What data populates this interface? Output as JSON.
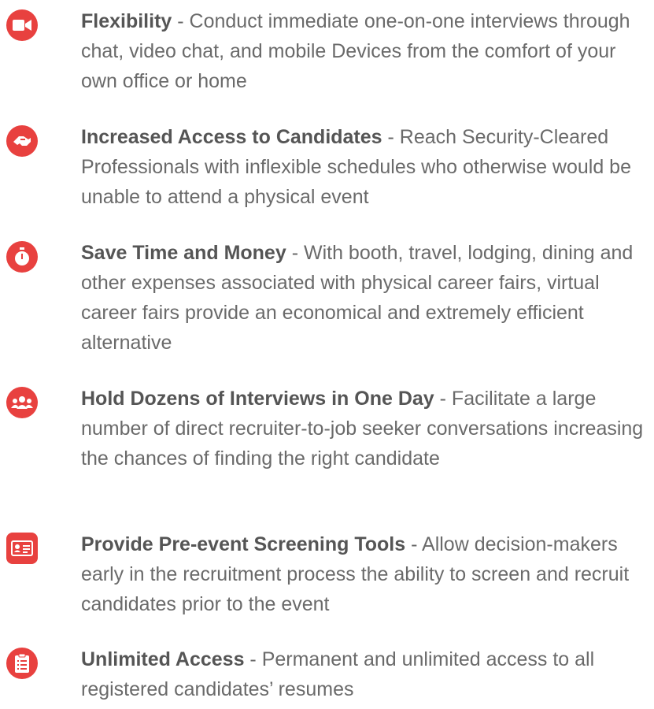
{
  "features": [
    {
      "icon": "video-camera-icon",
      "title": "Flexibility",
      "separator": " - ",
      "desc": "Conduct immediate one-on-one interviews through chat, video chat, and mobile Devices from the comfort of your own office or home"
    },
    {
      "icon": "handshake-icon",
      "title": "Increased Access to Candidates",
      "separator": " - ",
      "desc": "Reach Security-Cleared Professionals with inflexible schedules who otherwise would be unable to attend a physical event"
    },
    {
      "icon": "stopwatch-icon",
      "title": "Save Time and Money",
      "separator": " - ",
      "desc": "With booth, travel, lodging, dining and other expenses associated with physical career fairs, virtual career fairs provide an economical and extremely efficient alternative"
    },
    {
      "icon": "users-icon",
      "title": "Hold Dozens of Interviews in One Day",
      "separator": " - ",
      "desc": "Facilitate a large number of direct recruiter-to-job seeker conversations increasing the chances of finding the right candidate"
    },
    {
      "icon": "id-card-icon",
      "title": "Provide Pre-event Screening Tools",
      "separator": " - ",
      "desc": "Allow decision-makers early in the recruitment process the ability to screen and recruit candidates prior to the event"
    },
    {
      "icon": "clipboard-list-icon",
      "title": "Unlimited Access",
      "separator": " - ",
      "desc": "Permanent and unlimited access to all registered candidates’ resumes"
    }
  ],
  "colors": {
    "accent": "#e8413f",
    "title_text": "#555555",
    "body_text": "#6a6a6a"
  }
}
